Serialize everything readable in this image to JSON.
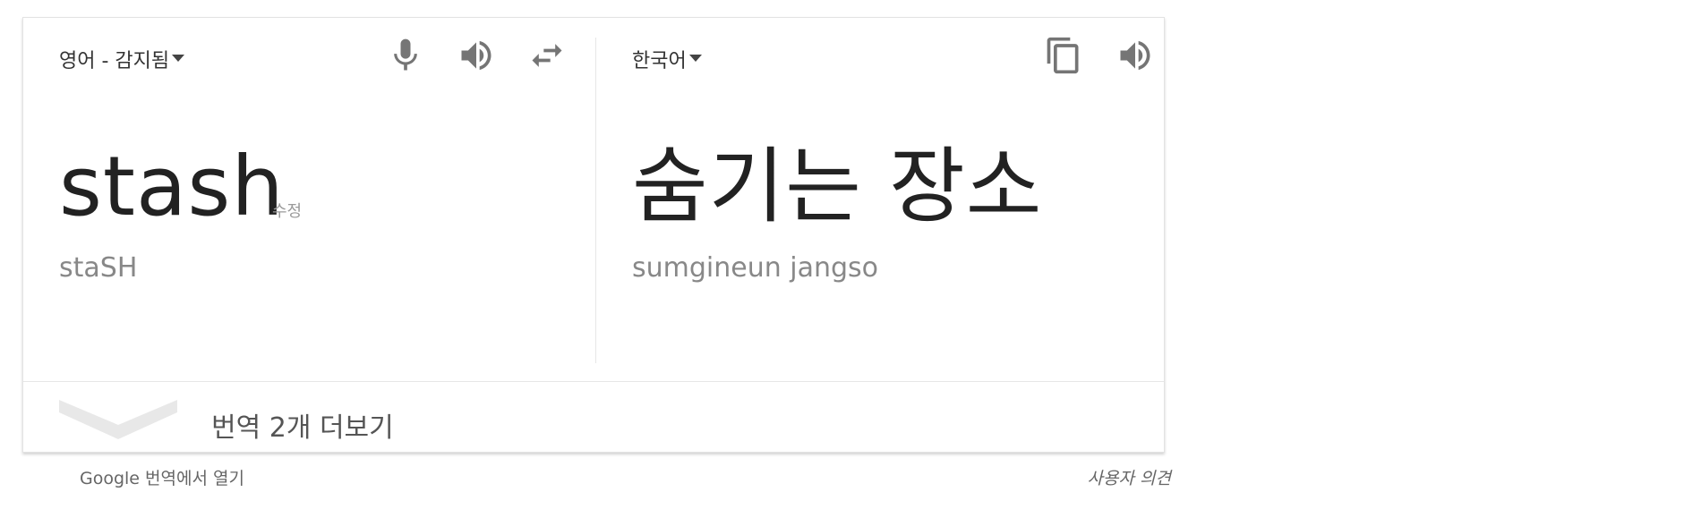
{
  "source": {
    "language": "영어 - 감지됨",
    "text": "stash",
    "edit_label": "수정",
    "pronunciation": "staSH",
    "icons": [
      "mic-icon",
      "speaker-icon",
      "swap-icon"
    ]
  },
  "target": {
    "language": "한국어",
    "text": "숨기는 장소",
    "pronunciation": "sumgineun jangso",
    "icons": [
      "copy-icon",
      "speaker-icon"
    ]
  },
  "more_translations": "번역 2개 더보기",
  "footer": {
    "open_in_translate": "Google 번역에서 열기",
    "feedback": "사용자 의견"
  },
  "colors": {
    "icon": "#757575",
    "text_primary": "#222222",
    "text_secondary": "#888888",
    "chevron": "#e8e8e8"
  }
}
